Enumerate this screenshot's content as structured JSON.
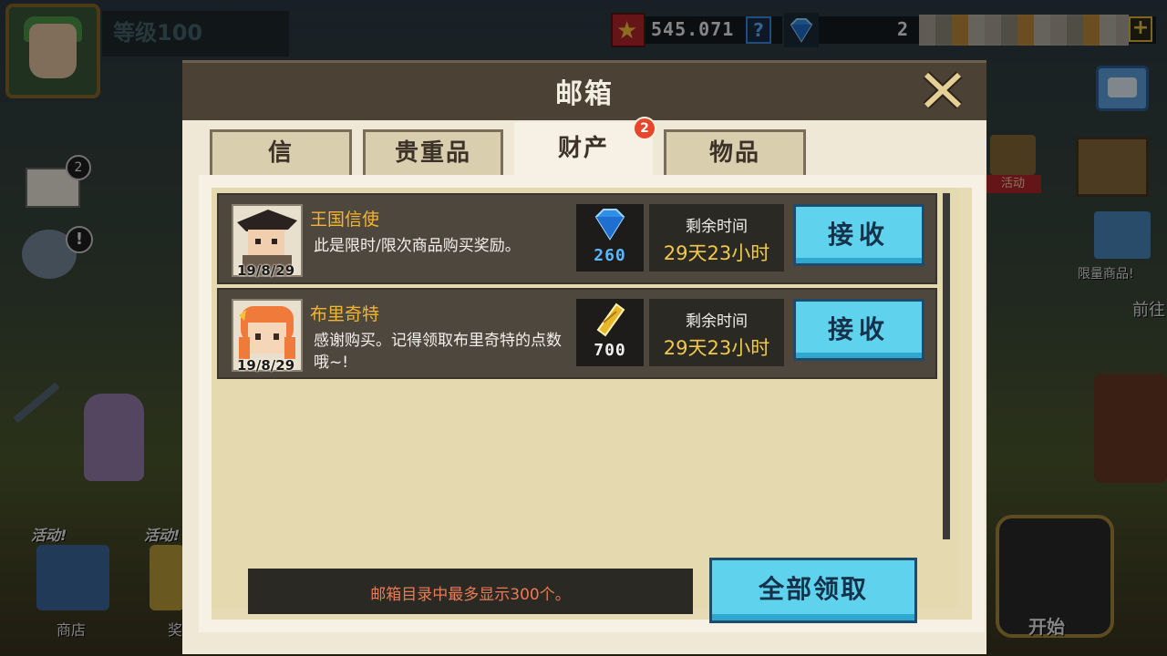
{
  "hud": {
    "level": "等级100",
    "medal_value": "545.071",
    "help_label": "?",
    "gem_value": "2",
    "add_label": "+"
  },
  "side": {
    "event_label": "活动",
    "limited_label": "限量商品!",
    "forward_label": "前往",
    "start_label": "开始",
    "mail_badge": "2",
    "alert_badge": "!",
    "shop_activity": "活动!",
    "shop_label": "商店",
    "reward_activity": "活动!",
    "reward_label": "奖励"
  },
  "dialog": {
    "title": "邮箱",
    "tabs": [
      {
        "label": "信",
        "active": false
      },
      {
        "label": "贵重品",
        "active": false
      },
      {
        "label": "财产",
        "active": true,
        "badge": "2"
      },
      {
        "label": "物品",
        "active": false
      }
    ],
    "mails": [
      {
        "sender": "王国信使",
        "message": "此是限时/限次商品购买奖励。",
        "date": "19/8/29",
        "reward_icon": "diamond-icon",
        "reward_value": "260",
        "time_label": "剩余时间",
        "time_value": "29天23小时",
        "button": "接收"
      },
      {
        "sender": "布里奇特",
        "message": "感谢购买。记得领取布里奇特的点数哦~!",
        "date": "19/8/29",
        "reward_icon": "gold-ticket-icon",
        "reward_value": "700",
        "time_label": "剩余时间",
        "time_value": "29天23小时",
        "button": "接收"
      }
    ],
    "footer_note": "邮箱目录中最多显示300个。",
    "claim_all": "全部领取"
  },
  "colors": {
    "header": "#4b4135",
    "body": "#efe8d6",
    "button": "#5fd2ee",
    "gold_text": "#f2b531",
    "footer_text": "#ea7b55"
  }
}
